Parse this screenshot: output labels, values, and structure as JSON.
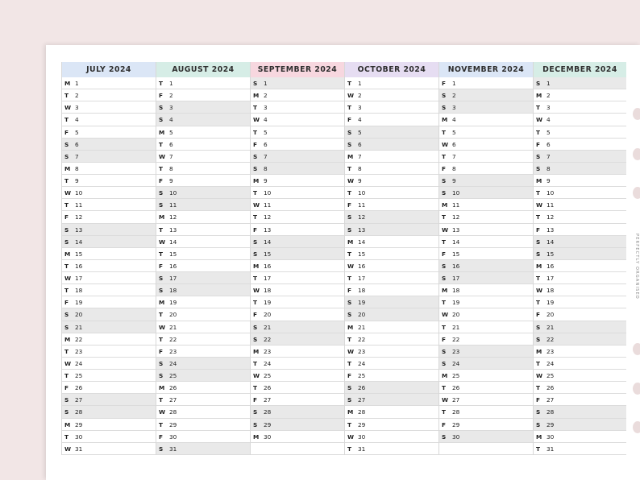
{
  "months": [
    {
      "name": "JULY 2024",
      "color": "#dbe6f6",
      "days": [
        {
          "wd": "M",
          "d": "1"
        },
        {
          "wd": "T",
          "d": "2"
        },
        {
          "wd": "W",
          "d": "3"
        },
        {
          "wd": "T",
          "d": "4"
        },
        {
          "wd": "F",
          "d": "5"
        },
        {
          "wd": "S",
          "d": "6",
          "we": true
        },
        {
          "wd": "S",
          "d": "7",
          "we": true
        },
        {
          "wd": "M",
          "d": "8"
        },
        {
          "wd": "T",
          "d": "9"
        },
        {
          "wd": "W",
          "d": "10"
        },
        {
          "wd": "T",
          "d": "11"
        },
        {
          "wd": "F",
          "d": "12"
        },
        {
          "wd": "S",
          "d": "13",
          "we": true
        },
        {
          "wd": "S",
          "d": "14",
          "we": true
        },
        {
          "wd": "M",
          "d": "15"
        },
        {
          "wd": "T",
          "d": "16"
        },
        {
          "wd": "W",
          "d": "17"
        },
        {
          "wd": "T",
          "d": "18"
        },
        {
          "wd": "F",
          "d": "19"
        },
        {
          "wd": "S",
          "d": "20",
          "we": true
        },
        {
          "wd": "S",
          "d": "21",
          "we": true
        },
        {
          "wd": "M",
          "d": "22"
        },
        {
          "wd": "T",
          "d": "23"
        },
        {
          "wd": "W",
          "d": "24"
        },
        {
          "wd": "T",
          "d": "25"
        },
        {
          "wd": "F",
          "d": "26"
        },
        {
          "wd": "S",
          "d": "27",
          "we": true
        },
        {
          "wd": "S",
          "d": "28",
          "we": true
        },
        {
          "wd": "M",
          "d": "29"
        },
        {
          "wd": "T",
          "d": "30"
        },
        {
          "wd": "W",
          "d": "31"
        }
      ]
    },
    {
      "name": "AUGUST 2024",
      "color": "#d6ede6",
      "days": [
        {
          "wd": "T",
          "d": "1"
        },
        {
          "wd": "F",
          "d": "2"
        },
        {
          "wd": "S",
          "d": "3",
          "we": true
        },
        {
          "wd": "S",
          "d": "4",
          "we": true
        },
        {
          "wd": "M",
          "d": "5"
        },
        {
          "wd": "T",
          "d": "6"
        },
        {
          "wd": "W",
          "d": "7"
        },
        {
          "wd": "T",
          "d": "8"
        },
        {
          "wd": "F",
          "d": "9"
        },
        {
          "wd": "S",
          "d": "10",
          "we": true
        },
        {
          "wd": "S",
          "d": "11",
          "we": true
        },
        {
          "wd": "M",
          "d": "12"
        },
        {
          "wd": "T",
          "d": "13"
        },
        {
          "wd": "W",
          "d": "14"
        },
        {
          "wd": "T",
          "d": "15"
        },
        {
          "wd": "F",
          "d": "16"
        },
        {
          "wd": "S",
          "d": "17",
          "we": true
        },
        {
          "wd": "S",
          "d": "18",
          "we": true
        },
        {
          "wd": "M",
          "d": "19"
        },
        {
          "wd": "T",
          "d": "20"
        },
        {
          "wd": "W",
          "d": "21"
        },
        {
          "wd": "T",
          "d": "22"
        },
        {
          "wd": "F",
          "d": "23"
        },
        {
          "wd": "S",
          "d": "24",
          "we": true
        },
        {
          "wd": "S",
          "d": "25",
          "we": true
        },
        {
          "wd": "M",
          "d": "26"
        },
        {
          "wd": "T",
          "d": "27"
        },
        {
          "wd": "W",
          "d": "28"
        },
        {
          "wd": "T",
          "d": "29"
        },
        {
          "wd": "F",
          "d": "30"
        },
        {
          "wd": "S",
          "d": "31",
          "we": true
        }
      ]
    },
    {
      "name": "SEPTEMBER 2024",
      "color": "#f7d7df",
      "days": [
        {
          "wd": "S",
          "d": "1",
          "we": true
        },
        {
          "wd": "M",
          "d": "2"
        },
        {
          "wd": "T",
          "d": "3"
        },
        {
          "wd": "W",
          "d": "4"
        },
        {
          "wd": "T",
          "d": "5"
        },
        {
          "wd": "F",
          "d": "6"
        },
        {
          "wd": "S",
          "d": "7",
          "we": true
        },
        {
          "wd": "S",
          "d": "8",
          "we": true
        },
        {
          "wd": "M",
          "d": "9"
        },
        {
          "wd": "T",
          "d": "10"
        },
        {
          "wd": "W",
          "d": "11"
        },
        {
          "wd": "T",
          "d": "12"
        },
        {
          "wd": "F",
          "d": "13"
        },
        {
          "wd": "S",
          "d": "14",
          "we": true
        },
        {
          "wd": "S",
          "d": "15",
          "we": true
        },
        {
          "wd": "M",
          "d": "16"
        },
        {
          "wd": "T",
          "d": "17"
        },
        {
          "wd": "W",
          "d": "18"
        },
        {
          "wd": "T",
          "d": "19"
        },
        {
          "wd": "F",
          "d": "20"
        },
        {
          "wd": "S",
          "d": "21",
          "we": true
        },
        {
          "wd": "S",
          "d": "22",
          "we": true
        },
        {
          "wd": "M",
          "d": "23"
        },
        {
          "wd": "T",
          "d": "24"
        },
        {
          "wd": "W",
          "d": "25"
        },
        {
          "wd": "T",
          "d": "26"
        },
        {
          "wd": "F",
          "d": "27"
        },
        {
          "wd": "S",
          "d": "28",
          "we": true
        },
        {
          "wd": "S",
          "d": "29",
          "we": true
        },
        {
          "wd": "M",
          "d": "30"
        },
        {
          "wd": "",
          "d": ""
        }
      ]
    },
    {
      "name": "OCTOBER 2024",
      "color": "#e6ddf2",
      "days": [
        {
          "wd": "T",
          "d": "1"
        },
        {
          "wd": "W",
          "d": "2"
        },
        {
          "wd": "T",
          "d": "3"
        },
        {
          "wd": "F",
          "d": "4"
        },
        {
          "wd": "S",
          "d": "5",
          "we": true
        },
        {
          "wd": "S",
          "d": "6",
          "we": true
        },
        {
          "wd": "M",
          "d": "7"
        },
        {
          "wd": "T",
          "d": "8"
        },
        {
          "wd": "W",
          "d": "9"
        },
        {
          "wd": "T",
          "d": "10"
        },
        {
          "wd": "F",
          "d": "11"
        },
        {
          "wd": "S",
          "d": "12",
          "we": true
        },
        {
          "wd": "S",
          "d": "13",
          "we": true
        },
        {
          "wd": "M",
          "d": "14"
        },
        {
          "wd": "T",
          "d": "15"
        },
        {
          "wd": "W",
          "d": "16"
        },
        {
          "wd": "T",
          "d": "17"
        },
        {
          "wd": "F",
          "d": "18"
        },
        {
          "wd": "S",
          "d": "19",
          "we": true
        },
        {
          "wd": "S",
          "d": "20",
          "we": true
        },
        {
          "wd": "M",
          "d": "21"
        },
        {
          "wd": "T",
          "d": "22"
        },
        {
          "wd": "W",
          "d": "23"
        },
        {
          "wd": "T",
          "d": "24"
        },
        {
          "wd": "F",
          "d": "25"
        },
        {
          "wd": "S",
          "d": "26",
          "we": true
        },
        {
          "wd": "S",
          "d": "27",
          "we": true
        },
        {
          "wd": "M",
          "d": "28"
        },
        {
          "wd": "T",
          "d": "29"
        },
        {
          "wd": "W",
          "d": "30"
        },
        {
          "wd": "T",
          "d": "31"
        }
      ]
    },
    {
      "name": "NOVEMBER 2024",
      "color": "#dbe6f6",
      "days": [
        {
          "wd": "F",
          "d": "1"
        },
        {
          "wd": "S",
          "d": "2",
          "we": true
        },
        {
          "wd": "S",
          "d": "3",
          "we": true
        },
        {
          "wd": "M",
          "d": "4"
        },
        {
          "wd": "T",
          "d": "5"
        },
        {
          "wd": "W",
          "d": "6"
        },
        {
          "wd": "T",
          "d": "7"
        },
        {
          "wd": "F",
          "d": "8"
        },
        {
          "wd": "S",
          "d": "9",
          "we": true
        },
        {
          "wd": "S",
          "d": "10",
          "we": true
        },
        {
          "wd": "M",
          "d": "11"
        },
        {
          "wd": "T",
          "d": "12"
        },
        {
          "wd": "W",
          "d": "13"
        },
        {
          "wd": "T",
          "d": "14"
        },
        {
          "wd": "F",
          "d": "15"
        },
        {
          "wd": "S",
          "d": "16",
          "we": true
        },
        {
          "wd": "S",
          "d": "17",
          "we": true
        },
        {
          "wd": "M",
          "d": "18"
        },
        {
          "wd": "T",
          "d": "19"
        },
        {
          "wd": "W",
          "d": "20"
        },
        {
          "wd": "T",
          "d": "21"
        },
        {
          "wd": "F",
          "d": "22"
        },
        {
          "wd": "S",
          "d": "23",
          "we": true
        },
        {
          "wd": "S",
          "d": "24",
          "we": true
        },
        {
          "wd": "M",
          "d": "25"
        },
        {
          "wd": "T",
          "d": "26"
        },
        {
          "wd": "W",
          "d": "27"
        },
        {
          "wd": "T",
          "d": "28"
        },
        {
          "wd": "F",
          "d": "29"
        },
        {
          "wd": "S",
          "d": "30",
          "we": true
        },
        {
          "wd": "",
          "d": ""
        }
      ]
    },
    {
      "name": "DECEMBER 2024",
      "color": "#d6ede6",
      "days": [
        {
          "wd": "S",
          "d": "1",
          "we": true
        },
        {
          "wd": "M",
          "d": "2"
        },
        {
          "wd": "T",
          "d": "3"
        },
        {
          "wd": "W",
          "d": "4"
        },
        {
          "wd": "T",
          "d": "5"
        },
        {
          "wd": "F",
          "d": "6"
        },
        {
          "wd": "S",
          "d": "7",
          "we": true
        },
        {
          "wd": "S",
          "d": "8",
          "we": true
        },
        {
          "wd": "M",
          "d": "9"
        },
        {
          "wd": "T",
          "d": "10"
        },
        {
          "wd": "W",
          "d": "11"
        },
        {
          "wd": "T",
          "d": "12"
        },
        {
          "wd": "F",
          "d": "13"
        },
        {
          "wd": "S",
          "d": "14",
          "we": true
        },
        {
          "wd": "S",
          "d": "15",
          "we": true
        },
        {
          "wd": "M",
          "d": "16"
        },
        {
          "wd": "T",
          "d": "17"
        },
        {
          "wd": "W",
          "d": "18"
        },
        {
          "wd": "T",
          "d": "19"
        },
        {
          "wd": "F",
          "d": "20"
        },
        {
          "wd": "S",
          "d": "21",
          "we": true
        },
        {
          "wd": "S",
          "d": "22",
          "we": true
        },
        {
          "wd": "M",
          "d": "23"
        },
        {
          "wd": "T",
          "d": "24"
        },
        {
          "wd": "W",
          "d": "25"
        },
        {
          "wd": "T",
          "d": "26"
        },
        {
          "wd": "F",
          "d": "27"
        },
        {
          "wd": "S",
          "d": "28",
          "we": true
        },
        {
          "wd": "S",
          "d": "29",
          "we": true
        },
        {
          "wd": "M",
          "d": "30"
        },
        {
          "wd": "T",
          "d": "31"
        }
      ]
    }
  ],
  "brand": "PERFECTLY ORGANISED"
}
